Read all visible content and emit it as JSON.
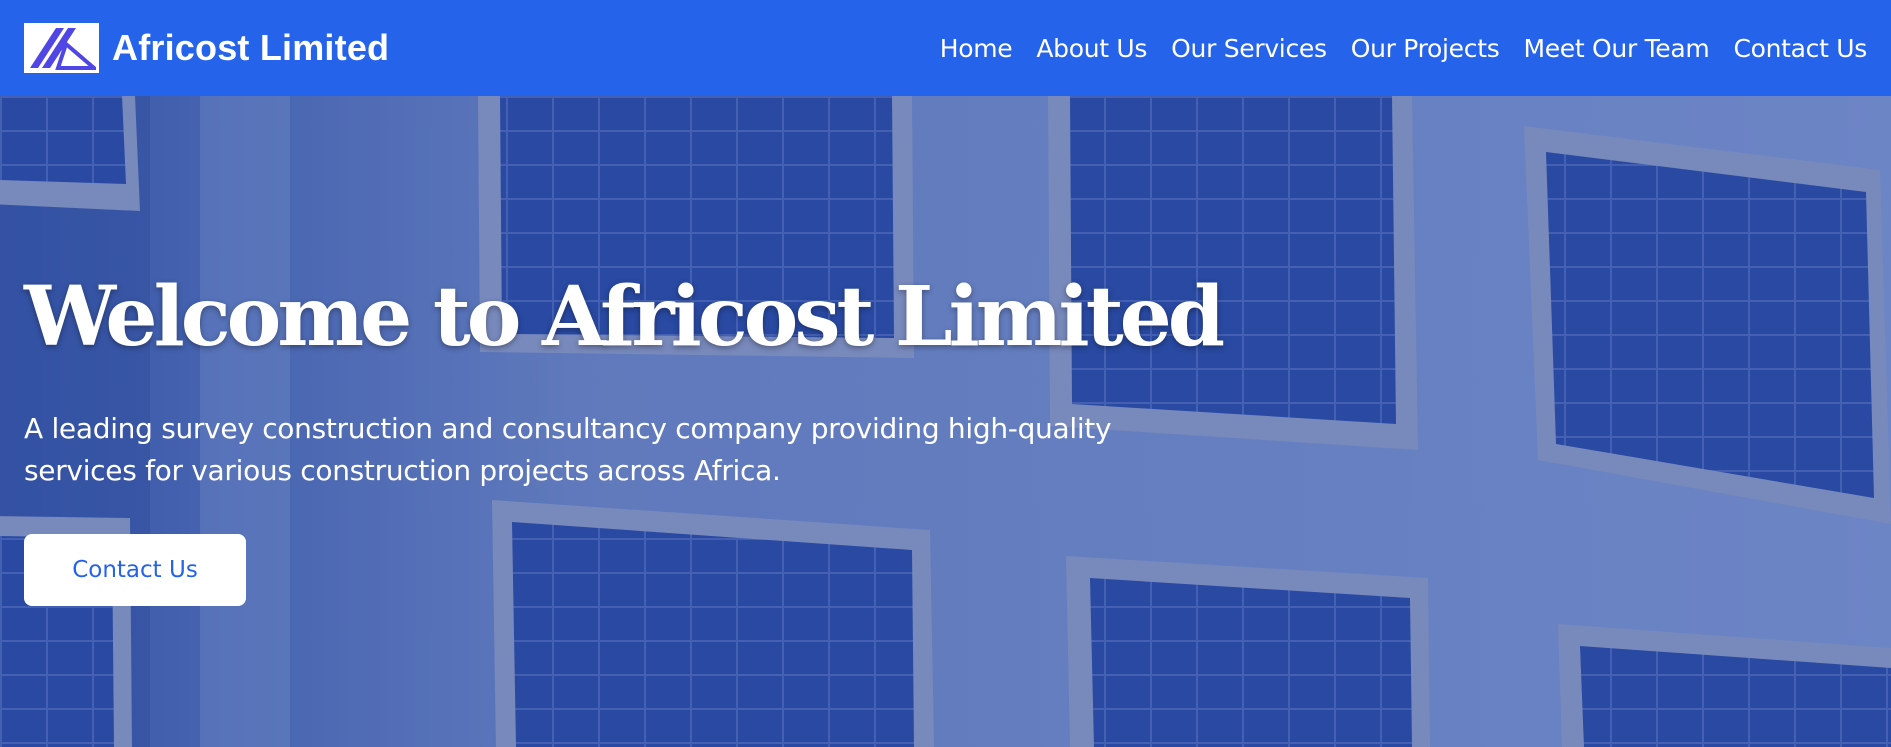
{
  "header": {
    "brand": "Africost Limited",
    "nav": [
      "Home",
      "About Us",
      "Our Services",
      "Our Projects",
      "Meet Our Team",
      "Contact Us"
    ]
  },
  "hero": {
    "title": "Welcome to Africost Limited",
    "subtitle": "A leading survey construction and consultancy company providing high-quality services for various construction projects across Africa.",
    "cta": "Contact Us"
  },
  "colors": {
    "primary": "#2563eb",
    "white": "#ffffff",
    "building_facade": "#6f88c4",
    "window_glass": "#2b4a9e"
  },
  "icons": {
    "logo": "africost-logo-icon"
  }
}
